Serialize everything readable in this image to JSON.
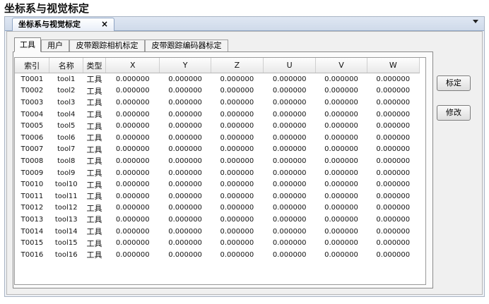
{
  "page_title": "坐标系与视觉标定",
  "doc_tab": {
    "label": "坐标系与视觉标定",
    "close": "×"
  },
  "sub_tabs": [
    {
      "label": "工具"
    },
    {
      "label": "用户"
    },
    {
      "label": "皮带跟踪相机标定"
    },
    {
      "label": "皮带跟踪编码器标定"
    }
  ],
  "table": {
    "columns": [
      "索引",
      "名称",
      "类型",
      "X",
      "Y",
      "Z",
      "U",
      "V",
      "W"
    ],
    "rows": [
      [
        "T0001",
        "tool1",
        "工具",
        "0.000000",
        "0.000000",
        "0.000000",
        "0.000000",
        "0.000000",
        "0.000000"
      ],
      [
        "T0002",
        "tool2",
        "工具",
        "0.000000",
        "0.000000",
        "0.000000",
        "0.000000",
        "0.000000",
        "0.000000"
      ],
      [
        "T0003",
        "tool3",
        "工具",
        "0.000000",
        "0.000000",
        "0.000000",
        "0.000000",
        "0.000000",
        "0.000000"
      ],
      [
        "T0004",
        "tool4",
        "工具",
        "0.000000",
        "0.000000",
        "0.000000",
        "0.000000",
        "0.000000",
        "0.000000"
      ],
      [
        "T0005",
        "tool5",
        "工具",
        "0.000000",
        "0.000000",
        "0.000000",
        "0.000000",
        "0.000000",
        "0.000000"
      ],
      [
        "T0006",
        "tool6",
        "工具",
        "0.000000",
        "0.000000",
        "0.000000",
        "0.000000",
        "0.000000",
        "0.000000"
      ],
      [
        "T0007",
        "tool7",
        "工具",
        "0.000000",
        "0.000000",
        "0.000000",
        "0.000000",
        "0.000000",
        "0.000000"
      ],
      [
        "T0008",
        "tool8",
        "工具",
        "0.000000",
        "0.000000",
        "0.000000",
        "0.000000",
        "0.000000",
        "0.000000"
      ],
      [
        "T0009",
        "tool9",
        "工具",
        "0.000000",
        "0.000000",
        "0.000000",
        "0.000000",
        "0.000000",
        "0.000000"
      ],
      [
        "T0010",
        "tool10",
        "工具",
        "0.000000",
        "0.000000",
        "0.000000",
        "0.000000",
        "0.000000",
        "0.000000"
      ],
      [
        "T0011",
        "tool11",
        "工具",
        "0.000000",
        "0.000000",
        "0.000000",
        "0.000000",
        "0.000000",
        "0.000000"
      ],
      [
        "T0012",
        "tool12",
        "工具",
        "0.000000",
        "0.000000",
        "0.000000",
        "0.000000",
        "0.000000",
        "0.000000"
      ],
      [
        "T0013",
        "tool13",
        "工具",
        "0.000000",
        "0.000000",
        "0.000000",
        "0.000000",
        "0.000000",
        "0.000000"
      ],
      [
        "T0014",
        "tool14",
        "工具",
        "0.000000",
        "0.000000",
        "0.000000",
        "0.000000",
        "0.000000",
        "0.000000"
      ],
      [
        "T0015",
        "tool15",
        "工具",
        "0.000000",
        "0.000000",
        "0.000000",
        "0.000000",
        "0.000000",
        "0.000000"
      ],
      [
        "T0016",
        "tool16",
        "工具",
        "0.000000",
        "0.000000",
        "0.000000",
        "0.000000",
        "0.000000",
        "0.000000"
      ]
    ]
  },
  "buttons": {
    "calibrate": "标定",
    "modify": "修改"
  },
  "icons": {
    "close": "close-icon",
    "dropdown": "chevron-down-icon"
  },
  "colors": {
    "tab_bar": "#cfdaea",
    "panel": "#f0f0f0",
    "grid_bg": "#ffffff"
  }
}
